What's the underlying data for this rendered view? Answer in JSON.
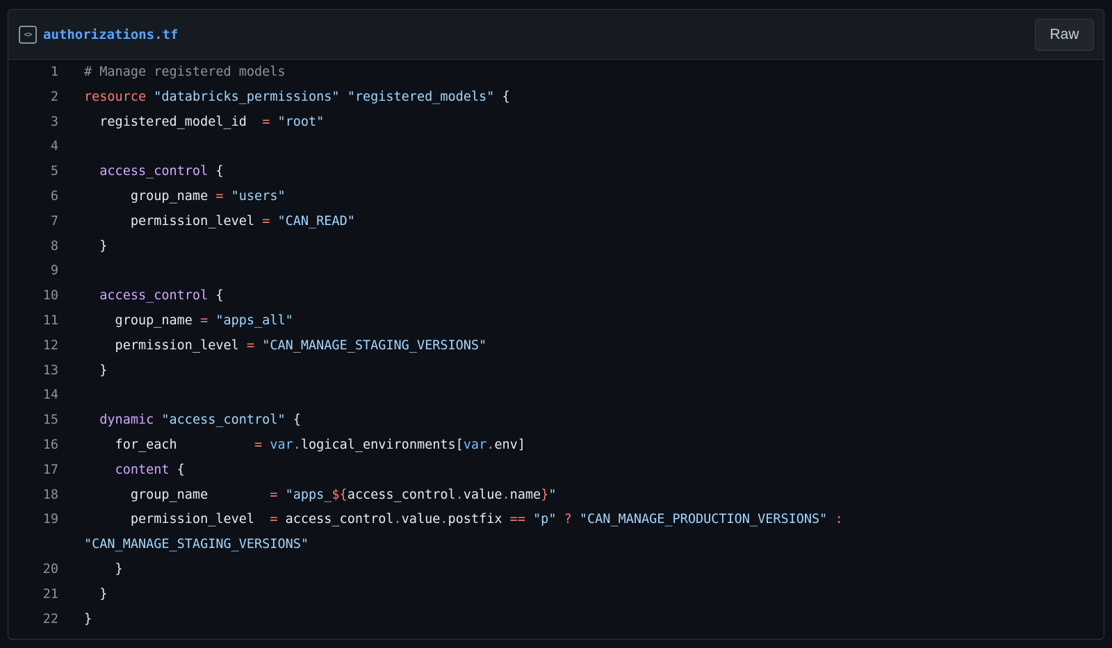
{
  "file": {
    "icon": "code-icon",
    "icon_glyph": "<>",
    "name": "authorizations.tf",
    "raw_label": "Raw"
  },
  "colors": {
    "background": "#0d1117",
    "header": "#161b22",
    "border": "#30363d",
    "link": "#58a6ff",
    "keyword": "#ff7b72",
    "string": "#a5d6ff",
    "block": "#d2a8ff",
    "comment": "#8b949e",
    "variable": "#79c0ff",
    "text": "#e6edf3"
  },
  "lines": [
    {
      "n": "1",
      "tokens": [
        [
          "com",
          "# Manage registered models"
        ]
      ]
    },
    {
      "n": "2",
      "tokens": [
        [
          "kw",
          "resource"
        ],
        [
          "",
          " "
        ],
        [
          "str",
          "\"databricks_permissions\""
        ],
        [
          "",
          " "
        ],
        [
          "str",
          "\"registered_models\""
        ],
        [
          "",
          " {"
        ]
      ]
    },
    {
      "n": "3",
      "tokens": [
        [
          "",
          "  registered_model_id  "
        ],
        [
          "op",
          "="
        ],
        [
          "",
          " "
        ],
        [
          "str",
          "\"root\""
        ]
      ]
    },
    {
      "n": "4",
      "tokens": []
    },
    {
      "n": "5",
      "tokens": [
        [
          "",
          "  "
        ],
        [
          "blk",
          "access_control"
        ],
        [
          "",
          " {"
        ]
      ]
    },
    {
      "n": "6",
      "tokens": [
        [
          "",
          "      group_name "
        ],
        [
          "op",
          "="
        ],
        [
          "",
          " "
        ],
        [
          "str",
          "\"users\""
        ]
      ]
    },
    {
      "n": "7",
      "tokens": [
        [
          "",
          "      permission_level "
        ],
        [
          "op",
          "="
        ],
        [
          "",
          " "
        ],
        [
          "str",
          "\"CAN_READ\""
        ]
      ]
    },
    {
      "n": "8",
      "tokens": [
        [
          "",
          "  }"
        ]
      ]
    },
    {
      "n": "9",
      "tokens": []
    },
    {
      "n": "10",
      "tokens": [
        [
          "",
          "  "
        ],
        [
          "blk",
          "access_control"
        ],
        [
          "",
          " {"
        ]
      ]
    },
    {
      "n": "11",
      "tokens": [
        [
          "",
          "    group_name "
        ],
        [
          "op",
          "="
        ],
        [
          "",
          " "
        ],
        [
          "str",
          "\"apps_all\""
        ]
      ]
    },
    {
      "n": "12",
      "tokens": [
        [
          "",
          "    permission_level "
        ],
        [
          "op",
          "="
        ],
        [
          "",
          " "
        ],
        [
          "str",
          "\"CAN_MANAGE_STAGING_VERSIONS\""
        ]
      ]
    },
    {
      "n": "13",
      "tokens": [
        [
          "",
          "  }"
        ]
      ]
    },
    {
      "n": "14",
      "tokens": []
    },
    {
      "n": "15",
      "tokens": [
        [
          "",
          "  "
        ],
        [
          "blk",
          "dynamic"
        ],
        [
          "",
          " "
        ],
        [
          "str",
          "\"access_control\""
        ],
        [
          "",
          " {"
        ]
      ]
    },
    {
      "n": "16",
      "tokens": [
        [
          "",
          "    for_each          "
        ],
        [
          "op",
          "="
        ],
        [
          "",
          " "
        ],
        [
          "var",
          "var"
        ],
        [
          "op",
          "."
        ],
        [
          "",
          "logical_environments["
        ],
        [
          "var",
          "var"
        ],
        [
          "op",
          "."
        ],
        [
          "",
          "env]"
        ]
      ]
    },
    {
      "n": "17",
      "tokens": [
        [
          "",
          "    "
        ],
        [
          "blk",
          "content"
        ],
        [
          "",
          " {"
        ]
      ]
    },
    {
      "n": "18",
      "tokens": [
        [
          "",
          "      group_name        "
        ],
        [
          "op",
          "="
        ],
        [
          "",
          " "
        ],
        [
          "str",
          "\"apps_"
        ],
        [
          "op",
          "${"
        ],
        [
          "",
          "access_control"
        ],
        [
          "op",
          "."
        ],
        [
          "",
          "value"
        ],
        [
          "op",
          "."
        ],
        [
          "",
          "name"
        ],
        [
          "op",
          "}"
        ],
        [
          "str",
          "\""
        ]
      ]
    },
    {
      "n": "19",
      "tokens": [
        [
          "",
          "      permission_level  "
        ],
        [
          "op",
          "="
        ],
        [
          "",
          " access_control"
        ],
        [
          "op",
          "."
        ],
        [
          "",
          "value"
        ],
        [
          "op",
          "."
        ],
        [
          "",
          "postfix "
        ],
        [
          "op",
          "=="
        ],
        [
          "",
          " "
        ],
        [
          "str",
          "\"p\""
        ],
        [
          "",
          " "
        ],
        [
          "op",
          "?"
        ],
        [
          "",
          " "
        ],
        [
          "str",
          "\"CAN_MANAGE_PRODUCTION_VERSIONS\""
        ],
        [
          "",
          " "
        ],
        [
          "op",
          ":"
        ]
      ]
    },
    {
      "n": "",
      "tokens": [
        [
          "str",
          "\"CAN_MANAGE_STAGING_VERSIONS\""
        ]
      ]
    },
    {
      "n": "20",
      "tokens": [
        [
          "",
          "    }"
        ]
      ]
    },
    {
      "n": "21",
      "tokens": [
        [
          "",
          "  }"
        ]
      ]
    },
    {
      "n": "22",
      "tokens": [
        [
          "",
          "}"
        ]
      ]
    }
  ]
}
